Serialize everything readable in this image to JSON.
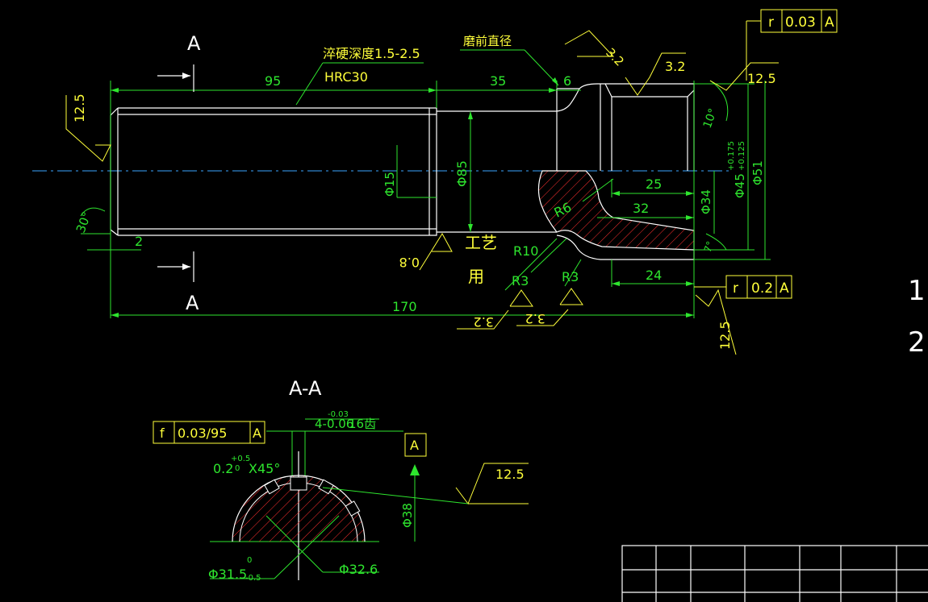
{
  "section_marks": {
    "top": "A",
    "bottom": "A"
  },
  "section_title": "A-A",
  "notes": {
    "hardening_depth": "淬硬深度1.5-2.5",
    "hardness": "HRC30",
    "pre_grind_diameter": "磨前直径",
    "process_1": "工艺",
    "process_2": "用"
  },
  "dimensions": {
    "len_95": "95",
    "len_35": "35",
    "len_6": "6",
    "len_25": "25",
    "len_32": "32",
    "len_24": "24",
    "len_170": "170",
    "len_2": "2",
    "dia_15": "Φ15",
    "dia_85": "Φ85",
    "dia_34": "Φ34",
    "dia_45": "Φ45",
    "dia_45_tol_upper": "+0.175",
    "dia_45_tol_lower": "+0.125",
    "dia_51": "Φ51",
    "r6": "R6",
    "r10": "R10",
    "r3_a": "R3",
    "r3_b": "R3",
    "ang_30": "30°",
    "ang_10": "10°",
    "ang_7": "7°",
    "chamfer": "0.2",
    "chamfer_tol_upper": "+0.5",
    "chamfer_tol_lower": "0",
    "chamfer_angle": "X45°",
    "spline_width": "4-0.06",
    "spline_tol_upper": "-0.03",
    "spline_teeth": "16齿",
    "dia_38": "Φ38",
    "dia_31_5": "Φ31.5",
    "dia_31_5_tol_upper": "0",
    "dia_31_5_tol_lower": "-0.5",
    "dia_32_6": "Φ32.6"
  },
  "roughness": {
    "left": "12.5",
    "top_a": "3.2",
    "top_b": "3.2",
    "top_right": "12.5",
    "bottom_left": "0.8",
    "bottom_r3_a": "3.2",
    "bottom_r3_b": "3.2",
    "bottom_right": "12.5",
    "section_right": "12.5"
  },
  "tolerance_frames": {
    "top": {
      "symbol": "r",
      "value": "0.03",
      "datum": "A"
    },
    "right": {
      "symbol": "r",
      "value": "0.2",
      "datum": "A"
    },
    "section": {
      "symbol": "f",
      "value": "0.03/95",
      "datum": "A"
    }
  },
  "datum": "A",
  "right_notes": [
    "1.",
    "2"
  ],
  "colors": {
    "part": "#ffffff",
    "dimension": "#2ee52e",
    "annotation": "#ffff3a",
    "hatch": "#ff3030",
    "center": "#3aa6ff"
  }
}
